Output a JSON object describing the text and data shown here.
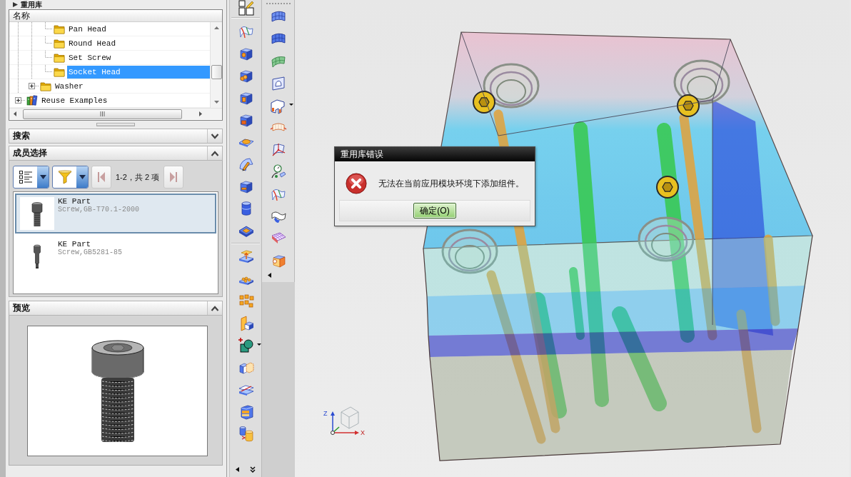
{
  "panel": {
    "title": "重用库"
  },
  "tree": {
    "column": "名称",
    "items": [
      {
        "children": [
          {
            "children": [
              {
                "label": "Pan Head",
                "selected": false
              },
              {
                "label": "Round Head",
                "selected": false
              },
              {
                "label": "Set Screw",
                "selected": false
              },
              {
                "label": "Socket Head",
                "selected": true
              }
            ]
          },
          {
            "label": "Washer",
            "selected": false,
            "expanded": false
          }
        ]
      },
      {
        "label": "Reuse Examples",
        "selected": false,
        "expanded": false
      }
    ]
  },
  "search_section": {
    "title": "搜索",
    "expanded": false
  },
  "member_selection": {
    "title": "成员选择",
    "expanded": true,
    "paging": "1-2，共 2 项",
    "items": [
      {
        "title": "KE Part",
        "description": "Screw,GB-T70.1-2000",
        "selected": true
      },
      {
        "title": "KE Part",
        "description": "Screw,GB5281-85",
        "selected": false
      }
    ]
  },
  "preview": {
    "title": "预览",
    "expanded": true
  },
  "error_dialog": {
    "title": "重用库错误",
    "message": "无法在当前应用模块环境下添加组件。",
    "button": "确定(O)"
  },
  "view_triad": {
    "z_label": "Z",
    "x_label": "X"
  }
}
